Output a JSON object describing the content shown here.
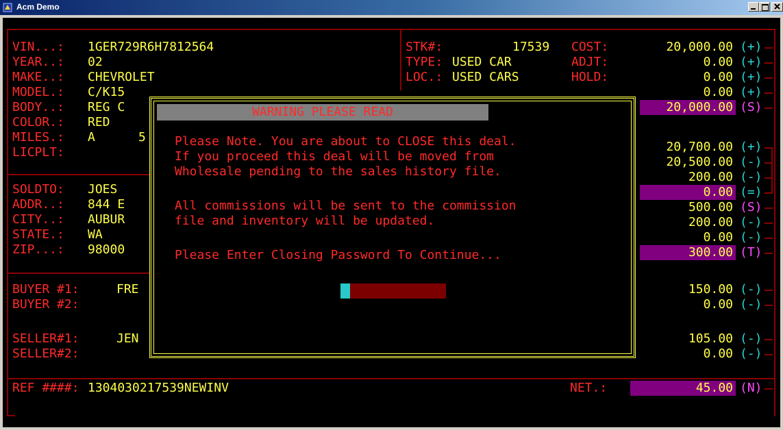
{
  "window": {
    "title": "Acm Demo",
    "icon": "app-icon",
    "buttons": [
      "minimize-icon",
      "maximize-icon",
      "close-icon"
    ]
  },
  "vehicle": {
    "vin_label": "VIN...:",
    "vin": "1GER729R6H7812564",
    "year_label": "YEAR..:",
    "year": "02",
    "make_label": "MAKE..:",
    "make": "CHEVROLET",
    "model_label": "MODEL.:",
    "model": "C/K15",
    "body_label": "BODY..:",
    "body": "REG C",
    "color_label": "COLOR.:",
    "color": "RED",
    "miles_label": "MILES.:",
    "miles_code": "A",
    "miles": "5",
    "licplt_label": "LICPLT:"
  },
  "stock": {
    "stk_label": "STK#:",
    "stk": "17539",
    "type_label": "TYPE:",
    "type": "USED CAR",
    "loc_label": "LOC.:",
    "loc": "USED CARS",
    "cost_label": "COST:",
    "adjt_label": "ADJT:",
    "hold_label": "HOLD:"
  },
  "customer": {
    "soldto_label": "SOLDTO:",
    "soldto": "JOES",
    "addr_label": "ADDR..:",
    "addr": "844 E",
    "city_label": "CITY..:",
    "city": "AUBUR",
    "state_label": "STATE.:",
    "state": "WA",
    "zip_label": "ZIP...:",
    "zip": "98000"
  },
  "people": {
    "buyer1_label": "BUYER #1:",
    "buyer1": "FRE",
    "buyer2_label": "BUYER #2:",
    "seller1_label": "SELLER#1:",
    "seller1": "JEN",
    "seller2_label": "SELLER#2:"
  },
  "reference": {
    "ref_label": "REF ####:",
    "ref": "1304030217539NEWINV",
    "net_label": "NET.:",
    "net": "45.00",
    "net_op": "(N)"
  },
  "amounts": [
    {
      "value": "20,000.00",
      "op": "(+)"
    },
    {
      "value": "0.00",
      "op": "(+)"
    },
    {
      "value": "0.00",
      "op": "(+)"
    },
    {
      "value": "0.00",
      "op": "(+)"
    },
    {
      "value": "20,000.00",
      "op": "(S)"
    },
    {
      "value": "20,700.00",
      "op": "(+)"
    },
    {
      "value": "20,500.00",
      "op": "(-)"
    },
    {
      "value": "200.00",
      "op": "(-)"
    },
    {
      "value": "0.00",
      "op": "(=)"
    },
    {
      "value": "500.00",
      "op": "(S)"
    },
    {
      "value": "200.00",
      "op": "(-)"
    },
    {
      "value": "0.00",
      "op": "(-)"
    },
    {
      "value": "300.00",
      "op": "(T)"
    },
    {
      "value": "150.00",
      "op": "(-)"
    },
    {
      "value": "0.00",
      "op": "(-)"
    },
    {
      "value": "105.00",
      "op": "(-)"
    },
    {
      "value": "0.00",
      "op": "(-)"
    }
  ],
  "dialog": {
    "title": "WARNING PLEASE READ",
    "line1": "Please Note. You are about to CLOSE this deal.",
    "line2": "If you proceed this deal will be moved from",
    "line3": "Wholesale pending to the sales history file.",
    "line4": "All commissions will be sent to the commission",
    "line5": "file and inventory will be updated.",
    "prompt": "Please Enter Closing Password To Continue..."
  },
  "colors": {
    "screen_bg": "#000000",
    "label": "#ff2a2a",
    "value": "#ffff4a",
    "operator": "#28d7d7",
    "highlight": "#800080",
    "border": "#8b0000",
    "dialog_border": "#ffff4a"
  }
}
